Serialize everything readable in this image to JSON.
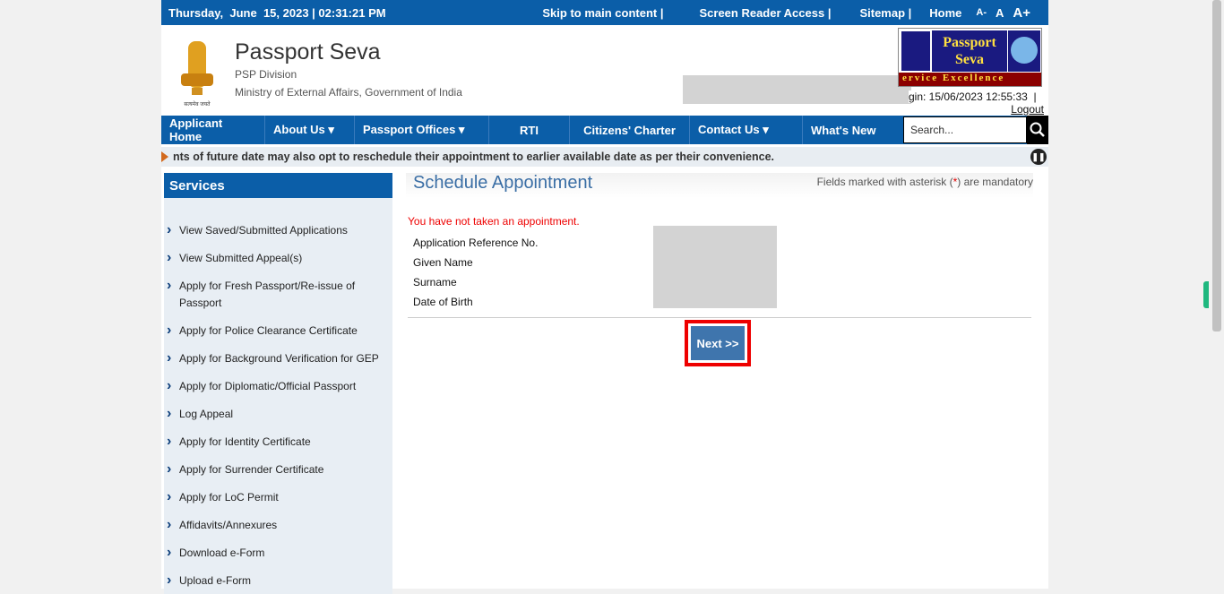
{
  "topbar": {
    "datetime": "Thursday,  June  15, 2023 | 02:31:21 PM",
    "skip": "Skip to main content  |",
    "screen_reader": "Screen Reader Access  |",
    "sitemap": "Sitemap  |",
    "home": "Home",
    "font_small": "A-",
    "font_normal": "A",
    "font_large": "A+"
  },
  "header": {
    "title": "Passport Seva",
    "division": "PSP Division",
    "ministry": "Ministry of External Affairs, Government of India",
    "emblem_text": "सत्यमेव जयते",
    "logo_line1": "Passport",
    "logo_line2": "Seva",
    "logo_tagline": "ervice Excellence",
    "last_login": "gin: 15/06/2023 12:55:33  |",
    "logout": "Logout"
  },
  "nav": {
    "items": [
      "Applicant Home",
      "About Us ▾",
      "Passport Offices ▾",
      "RTI",
      "Citizens' Charter",
      "Contact Us ▾",
      "What's New"
    ],
    "search_placeholder": "Search..."
  },
  "ticker": "nts of future date may also opt to reschedule their appointment to earlier available date as per their convenience.",
  "sidebar": {
    "title": "Services",
    "items": [
      "View Saved/Submitted Applications",
      "View Submitted Appeal(s)",
      "Apply for Fresh Passport/Re-issue of Passport",
      "Apply for Police Clearance Certificate",
      "Apply for Background Verification for GEP",
      "Apply for Diplomatic/Official Passport",
      "Log Appeal",
      "Apply for Identity Certificate",
      "Apply for Surrender Certificate",
      "Apply for LoC Permit",
      "Affidavits/Annexures",
      "Download e-Form",
      "Upload e-Form"
    ]
  },
  "main": {
    "title": "Schedule Appointment",
    "mandatory_pre": "Fields marked with asterisk (",
    "mandatory_star": "*",
    "mandatory_post": ") are mandatory",
    "error": "You have not taken an appointment.",
    "labels": [
      "Application Reference No.",
      "Given Name",
      "Surname",
      "Date of Birth"
    ],
    "next": "Next >>"
  }
}
